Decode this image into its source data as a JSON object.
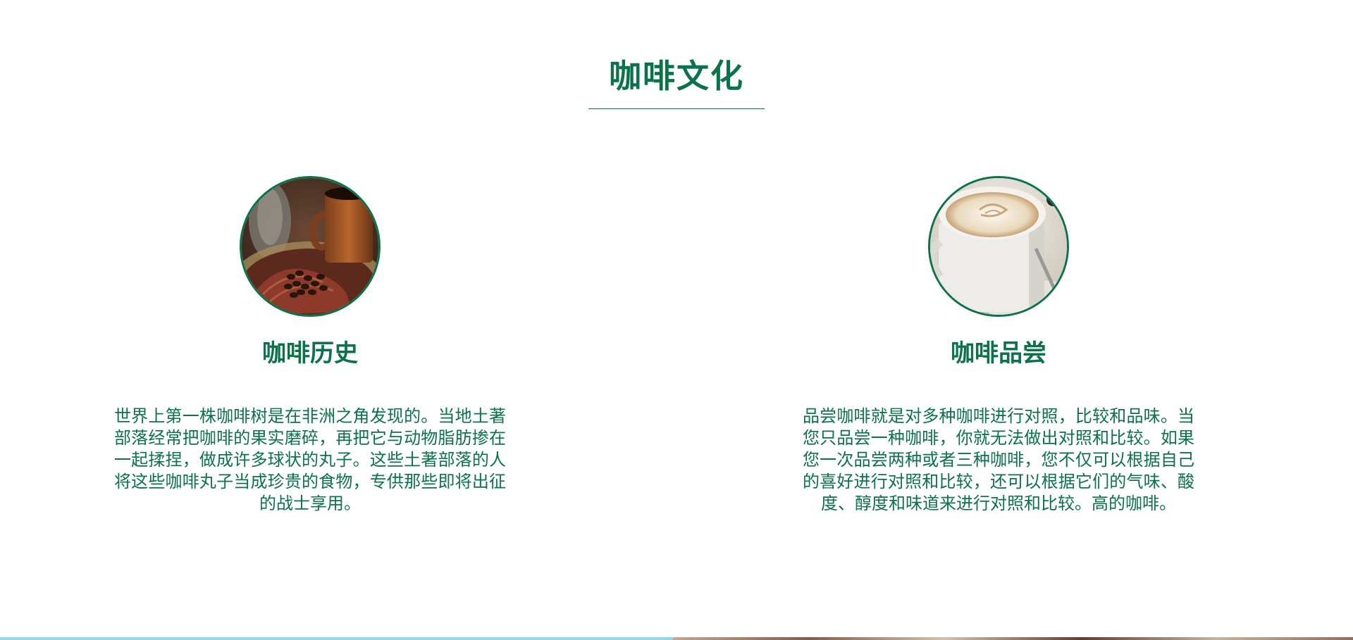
{
  "section": {
    "title": "咖啡文化"
  },
  "cards": [
    {
      "image": "coffee-beans-and-mug-photo",
      "title": "咖啡历史",
      "text": "世界上第一株咖啡树是在非洲之角发现的。当地土著部落经常把咖啡的果实磨碎，再把它与动物脂肪掺在一起揉捏，做成许多球状的丸子。这些土著部落的人将这些咖啡丸子当成珍贵的食物，专供那些即将出征的战士享用。"
    },
    {
      "image": "cappuccino-cup-photo",
      "title": "咖啡品尝",
      "text": "品尝咖啡就是对多种咖啡进行对照，比较和品味。当您只品尝一种咖啡，你就无法做出对照和比较。如果您一次品尝两种或者三种咖啡，您不仅可以根据自己的喜好进行对照和比较，还可以根据它们的气味、酸度、醇度和味道来进行对照和比较。高的咖啡。"
    }
  ],
  "colors": {
    "accent": "#0b7349",
    "background": "#ffffff"
  }
}
